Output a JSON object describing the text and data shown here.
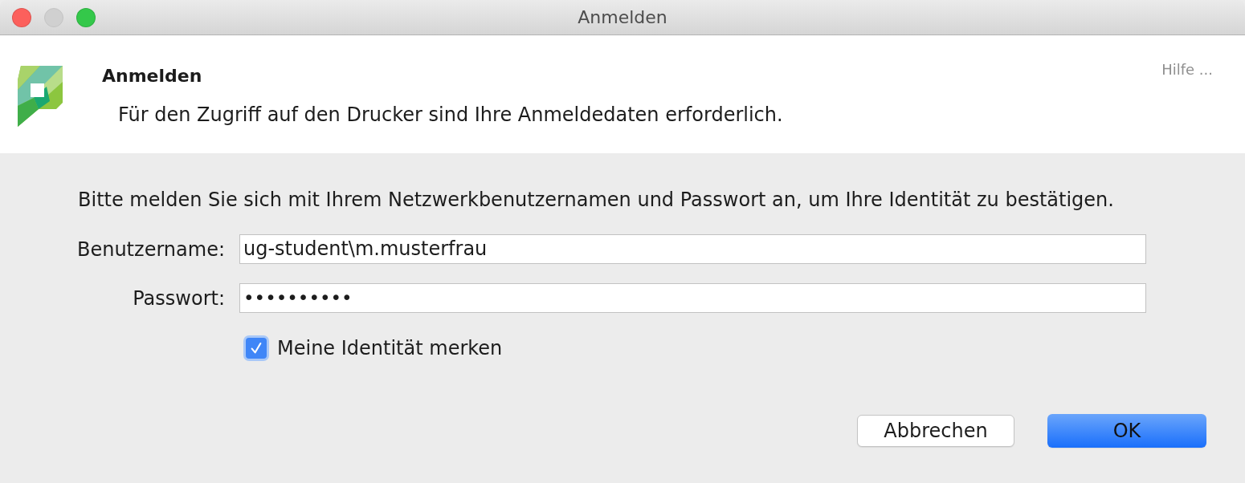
{
  "window": {
    "title": "Anmelden",
    "controls": [
      {
        "kind": "close",
        "disabled": false
      },
      {
        "kind": "minimize",
        "disabled": true
      },
      {
        "kind": "zoom",
        "disabled": false
      }
    ]
  },
  "header": {
    "title": "Anmelden",
    "message": "Für den Zugriff auf den Drucker sind Ihre Anmeldedaten erforderlich.",
    "help_link": "Hilfe ..."
  },
  "form": {
    "instruction": "Bitte melden Sie sich mit Ihrem Netzwerkbenutzernamen und Passwort an, um Ihre Identität zu bestätigen.",
    "fields": [
      {
        "kind": "username",
        "label": "Benutzername:",
        "value": "ug-student\\m.musterfrau"
      },
      {
        "kind": "password",
        "label": "Passwort:",
        "value": "••••••••••"
      }
    ],
    "remember": {
      "label": "Meine Identität merken",
      "checked": true
    }
  },
  "buttons": [
    {
      "label": "Abbrechen",
      "default": false
    },
    {
      "label": "OK",
      "default": true
    }
  ]
}
